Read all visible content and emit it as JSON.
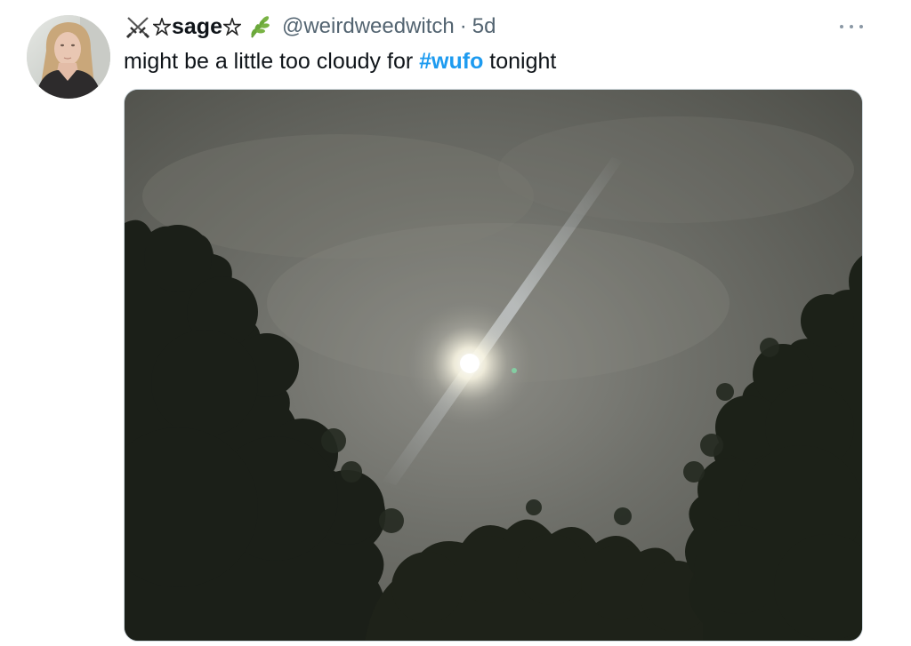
{
  "tweet": {
    "display_name": "sage",
    "handle": "@weirdweedwitch",
    "separator": "·",
    "time": "5d",
    "text_before": "might be a little too cloudy for ",
    "hashtag": "#wufo",
    "text_after": " tonight"
  },
  "icons": {
    "name_prefix": "crossed-swords-icon",
    "name_star": "pentagram-icon",
    "name_suffix": "herb-icon",
    "more": "more-options-icon"
  },
  "colors": {
    "text": "#0f1419",
    "secondary": "#536471",
    "link": "#1d9bf0",
    "media_border": "#cfd9de"
  }
}
